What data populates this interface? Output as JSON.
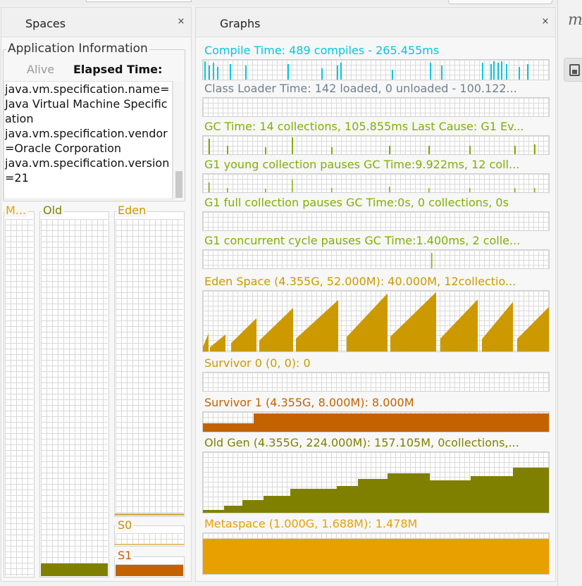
{
  "spaces_panel": {
    "tab_title": "Spaces",
    "close_glyph": "×",
    "app_info": {
      "title": "Application Information",
      "alive_label": "Alive",
      "elapsed_label": "Elapsed Time:",
      "properties_lines": [
        "java.vm.specification.name=",
        "Java Virtual Machine Specific",
        "ation",
        "java.vm.specification.vendor",
        "=Oracle Corporation",
        "java.vm.specification.version",
        "=21"
      ]
    },
    "spaces": [
      {
        "id": "metaspace",
        "label": "M...",
        "color": "#e8a000",
        "fill": 0.0
      },
      {
        "id": "old",
        "label": "Old",
        "color": "#808000",
        "fill": 0.035
      },
      {
        "id": "eden",
        "label": "Eden",
        "color": "#cc9900",
        "fill": 0.0
      },
      {
        "id": "s0",
        "label": "S0",
        "color": "#d4b050",
        "fill": 0.0
      },
      {
        "id": "s1",
        "label": "S1",
        "color": "#c46200",
        "fill": 1.0
      }
    ]
  },
  "graphs_panel": {
    "tab_title": "Graphs",
    "close_glyph": "×",
    "graphs": [
      {
        "id": "compile",
        "title": "Compile Time: 489 compiles - 265.455ms",
        "color": "#00c8e0"
      },
      {
        "id": "classloader",
        "title": "Class Loader Time: 142 loaded, 0 unloaded - 100.122...",
        "color": "#708090"
      },
      {
        "id": "gc",
        "title": "GC Time: 14 collections, 105.855ms Last Cause: G1 Ev...",
        "color": "#80b000"
      },
      {
        "id": "g1young",
        "title": "G1 young collection pauses GC Time:9.922ms, 12 coll...",
        "color": "#80b000"
      },
      {
        "id": "g1full",
        "title": "G1 full collection pauses GC Time:0s, 0 collections, 0s",
        "color": "#80b000"
      },
      {
        "id": "g1concurrent",
        "title": "G1 concurrent cycle pauses GC Time:1.400ms, 2 colle...",
        "color": "#80b000"
      },
      {
        "id": "eden",
        "title": "Eden Space (4.355G, 52.000M): 40.000M, 12collectio...",
        "color": "#cc9900"
      },
      {
        "id": "survivor0",
        "title": "Survivor 0 (0, 0): 0",
        "color": "#cc9900"
      },
      {
        "id": "survivor1",
        "title": "Survivor 1 (4.355G, 8.000M): 8.000M",
        "color": "#c46200"
      },
      {
        "id": "oldgen",
        "title": "Old Gen (4.355G, 224.000M): 157.105M, 0collections,...",
        "color": "#808000"
      },
      {
        "id": "metaspace",
        "title": "Metaspace (1.000G, 1.688M): 1.478M",
        "color": "#e8a000"
      }
    ]
  },
  "right_pane": {
    "label": "m",
    "button_icon": "save-icon"
  }
}
